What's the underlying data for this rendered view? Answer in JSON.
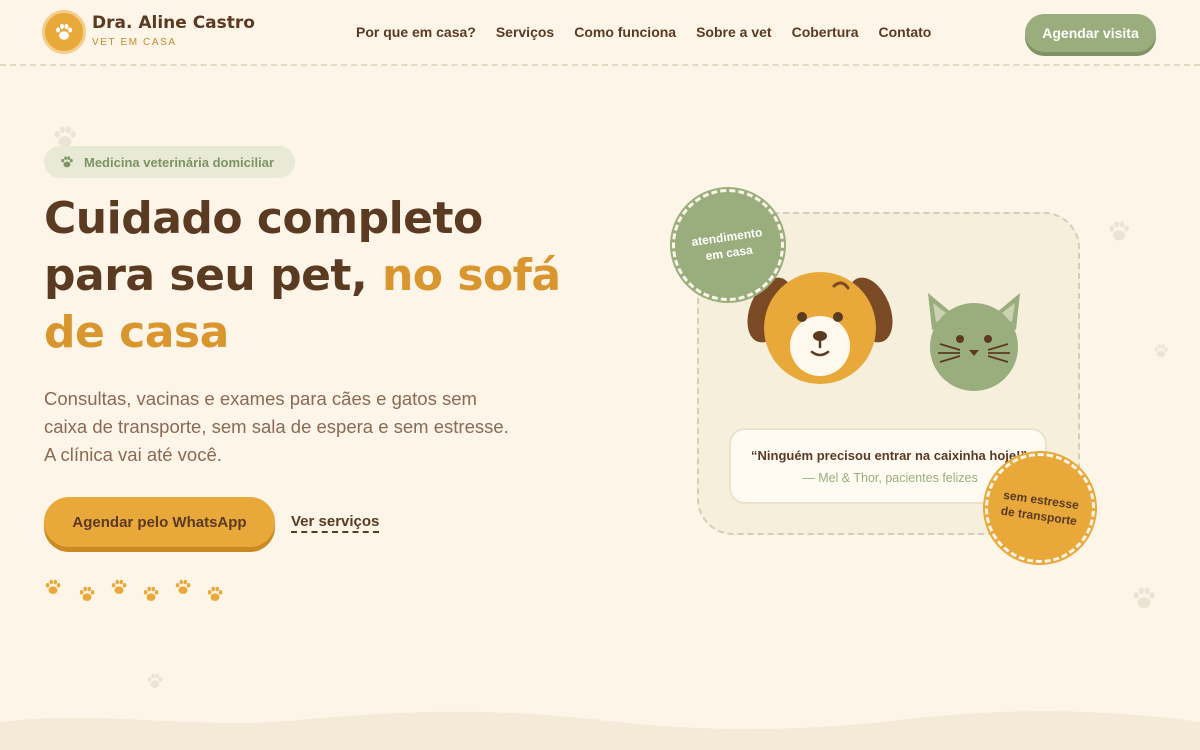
{
  "brand": {
    "name": "Dra. Aline Castro",
    "subtitle": "VET EM CASA",
    "logo_icon": "paw-icon"
  },
  "nav": {
    "items": [
      {
        "label": "Por que em casa?"
      },
      {
        "label": "Serviços"
      },
      {
        "label": "Como funciona"
      },
      {
        "label": "Sobre a vet"
      },
      {
        "label": "Cobertura"
      },
      {
        "label": "Contato"
      }
    ],
    "cta_label": "Agendar visita"
  },
  "hero": {
    "pill_label": "Medicina veterinária domiciliar",
    "title_part1": "Cuidado completo para seu pet, ",
    "title_accent": "no sofá de casa",
    "lead": "Consultas, vacinas e exames para cães e gatos sem caixa de transporte, sem sala de espera e sem estresse. A clínica vai até você.",
    "primary_button": "Agendar pelo WhatsApp",
    "secondary_link": "Ver serviços"
  },
  "illustration": {
    "badge_top": "atendimento em casa",
    "badge_bottom": "sem estresse de transporte",
    "quote_text": "“Ninguém precisou entrar na caixinha hoje!”",
    "quote_author": "— Mel & Thor, pacientes felizes"
  },
  "colors": {
    "background": "#fcf5e8",
    "brown": "#5b3a22",
    "orange": "#e8a83a",
    "green": "#9aae7d"
  }
}
